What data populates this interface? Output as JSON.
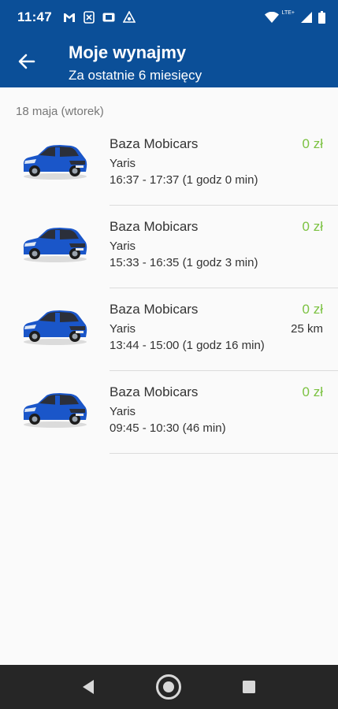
{
  "status_bar": {
    "time": "11:47",
    "network_label": "LTE+",
    "icons": [
      "gmail-icon",
      "app-notification-icon",
      "sim-card-icon",
      "vpn-icon",
      "wifi-icon",
      "signal-icon",
      "battery-icon"
    ]
  },
  "app_bar": {
    "title": "Moje wynajmy",
    "subtitle": "Za ostatnie 6 miesięcy",
    "back_icon": "arrow-left-icon"
  },
  "section": {
    "date_header": "18 maja (wtorek)"
  },
  "rentals": [
    {
      "location": "Baza Mobicars",
      "model": "Yaris",
      "time": "16:37 - 17:37 (1 godz 0 min)",
      "price": "0 zł",
      "distance": ""
    },
    {
      "location": "Baza Mobicars",
      "model": "Yaris",
      "time": "15:33 - 16:35 (1 godz 3 min)",
      "price": "0 zł",
      "distance": ""
    },
    {
      "location": "Baza Mobicars",
      "model": "Yaris",
      "time": "13:44 - 15:00 (1 godz 16 min)",
      "price": "0 zł",
      "distance": "25 km"
    },
    {
      "location": "Baza Mobicars",
      "model": "Yaris",
      "time": "09:45 - 10:30 (46 min)",
      "price": "0 zł",
      "distance": ""
    }
  ],
  "colors": {
    "primary": "#0b4f98",
    "price_green": "#7cc242",
    "car_blue": "#1a56c9",
    "nav_bar": "#262626"
  },
  "nav_bar": {
    "icons": [
      "back-triangle-icon",
      "home-circle-icon",
      "recents-square-icon"
    ]
  }
}
